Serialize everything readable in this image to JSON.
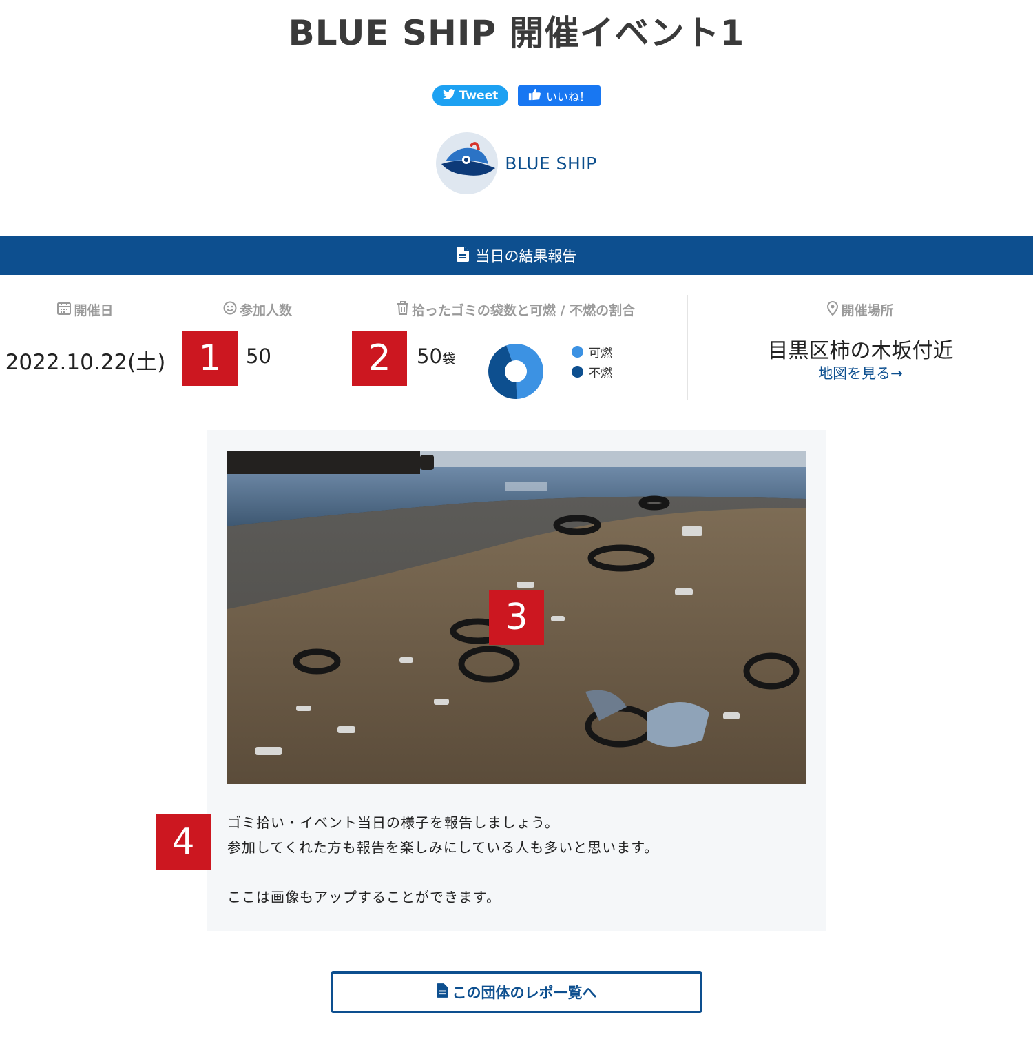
{
  "page": {
    "title": "BLUE SHIP 開催イベント1"
  },
  "share": {
    "tweet_label": "Tweet",
    "like_label": "いいね！"
  },
  "org": {
    "name": "BLUE SHIP"
  },
  "report_bar": {
    "label": "当日の結果報告"
  },
  "stats": {
    "date": {
      "heading": "開催日",
      "value": "2022.10.22(土)"
    },
    "participants": {
      "heading": "参加人数",
      "value": "50"
    },
    "garbage": {
      "heading": "拾ったゴミの袋数と可燃 / 不燃の割合",
      "value": "50",
      "unit": "袋",
      "legend": [
        {
          "label": "可燃",
          "color": "#3c92e3"
        },
        {
          "label": "不燃",
          "color": "#0d4f8f"
        }
      ]
    },
    "place": {
      "heading": "開催場所",
      "value": "目黒区柿の木坂付近",
      "map_link": "地図を見る→"
    }
  },
  "chart_data": {
    "type": "pie",
    "categories": [
      "可燃",
      "不燃"
    ],
    "values": [
      55,
      45
    ],
    "colors": [
      "#3c92e3",
      "#0d4f8f"
    ]
  },
  "badges": {
    "b1": "1",
    "b2": "2",
    "b3": "3",
    "b4": "4"
  },
  "report": {
    "lines": [
      "ゴミ拾い・イベント当日の様子を報告しましょう。",
      "参加してくれた方も報告を楽しみにしている人も多いと思います。",
      "",
      "ここは画像もアップすることができます。"
    ]
  },
  "list_button": {
    "label": "この団体のレポ一覧へ"
  }
}
